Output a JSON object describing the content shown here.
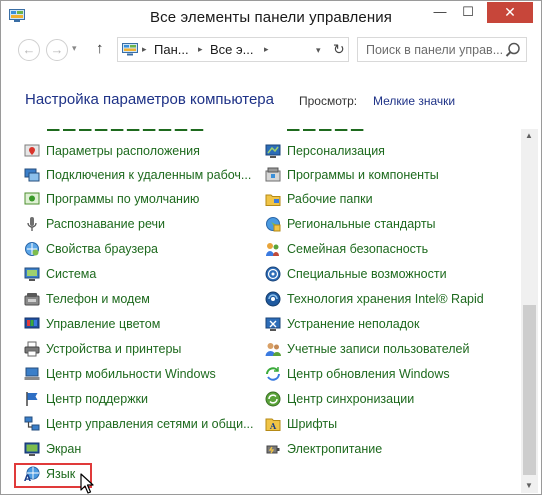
{
  "window": {
    "title": "Все элементы панели управления",
    "min_label": "—",
    "max_label": "☐",
    "close_label": "✕"
  },
  "nav": {
    "back_label": "←",
    "forward_label": "→",
    "recent_label": "▾",
    "up_label": "↑",
    "breadcrumbs": [
      "Пан...",
      "Все э..."
    ],
    "crumb_sep": "▸",
    "address_drop": "▾",
    "refresh_label": "↻",
    "search_placeholder": "Поиск в панели управ..."
  },
  "header": {
    "title": "Настройка параметров компьютера",
    "view_label": "Просмотр:",
    "view_value": "Мелкие значки"
  },
  "items_left": [
    {
      "label": "Параметры расположения",
      "icon": "location-icon"
    },
    {
      "label": "Подключения к удаленным рабоч...",
      "icon": "remote-desktop-icon"
    },
    {
      "label": "Программы по умолчанию",
      "icon": "default-programs-icon"
    },
    {
      "label": "Распознавание речи",
      "icon": "microphone-icon"
    },
    {
      "label": "Свойства браузера",
      "icon": "internet-options-icon"
    },
    {
      "label": "Система",
      "icon": "system-icon"
    },
    {
      "label": "Телефон и модем",
      "icon": "phone-modem-icon"
    },
    {
      "label": "Управление цветом",
      "icon": "color-management-icon"
    },
    {
      "label": "Устройства и принтеры",
      "icon": "printer-icon"
    },
    {
      "label": "Центр мобильности Windows",
      "icon": "mobility-center-icon"
    },
    {
      "label": "Центр поддержки",
      "icon": "flag-icon"
    },
    {
      "label": "Центр управления сетями и общи...",
      "icon": "network-icon"
    },
    {
      "label": "Экран",
      "icon": "display-icon"
    },
    {
      "label": "Язык",
      "icon": "language-icon"
    }
  ],
  "items_right": [
    {
      "label": "Персонализация",
      "icon": "personalization-icon"
    },
    {
      "label": "Программы и компоненты",
      "icon": "programs-features-icon"
    },
    {
      "label": "Рабочие папки",
      "icon": "work-folders-icon"
    },
    {
      "label": "Региональные стандарты",
      "icon": "region-icon"
    },
    {
      "label": "Семейная безопасность",
      "icon": "family-safety-icon"
    },
    {
      "label": "Специальные возможности",
      "icon": "accessibility-icon"
    },
    {
      "label": "Технология хранения Intel® Rapid",
      "icon": "intel-rst-icon"
    },
    {
      "label": "Устранение неполадок",
      "icon": "troubleshooting-icon"
    },
    {
      "label": "Учетные записи пользователей",
      "icon": "user-accounts-icon"
    },
    {
      "label": "Центр обновления Windows",
      "icon": "windows-update-icon"
    },
    {
      "label": "Центр синхронизации",
      "icon": "sync-center-icon"
    },
    {
      "label": "Шрифты",
      "icon": "fonts-icon"
    },
    {
      "label": "Электропитание",
      "icon": "power-options-icon"
    }
  ],
  "scrollbar": {
    "up_label": "▲",
    "down_label": "▼"
  },
  "colors": {
    "link_green": "#1e6a1e",
    "heading_blue": "#1e3287",
    "close_red": "#c7463a",
    "highlight_red": "#e03a3a"
  }
}
